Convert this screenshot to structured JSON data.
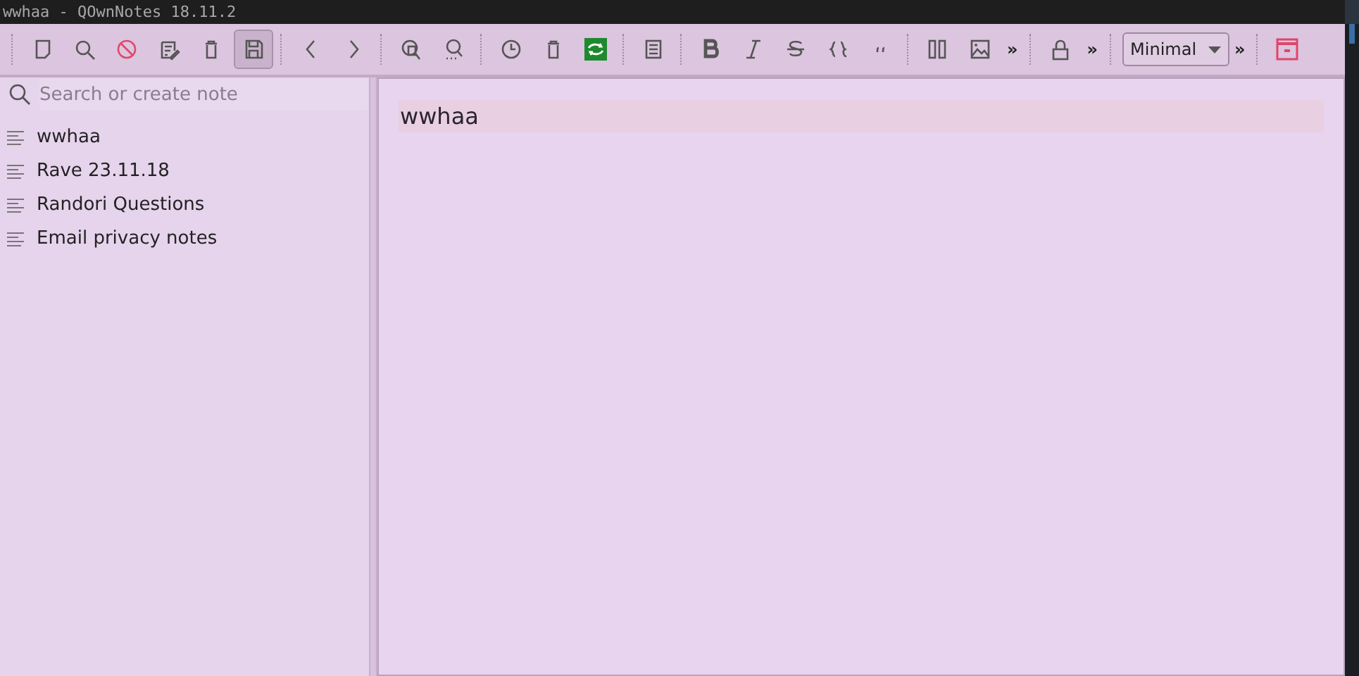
{
  "window": {
    "title": "wwhaa - QOwnNotes 18.11.2"
  },
  "toolbar": {
    "groups": [
      {
        "buttons": [
          {
            "pressed": false
          },
          {
            "pressed": false
          },
          {
            "pressed": false
          },
          {
            "pressed": false
          },
          {
            "pressed": false
          },
          {
            "pressed": true
          }
        ]
      },
      {
        "buttons": [
          {
            "pressed": false
          },
          {
            "pressed": false
          }
        ]
      },
      {
        "buttons": [
          {
            "pressed": false
          },
          {
            "pressed": false
          }
        ]
      },
      {
        "buttons": [
          {
            "pressed": false
          },
          {
            "pressed": false
          },
          {
            "pressed": false
          }
        ]
      },
      {
        "buttons": [
          {
            "pressed": false
          }
        ]
      },
      {
        "buttons": [
          {
            "pressed": false
          },
          {
            "pressed": false
          },
          {
            "pressed": false
          },
          {
            "pressed": false
          },
          {
            "pressed": false
          }
        ]
      },
      {
        "buttons": [
          {
            "pressed": false
          },
          {
            "pressed": false
          }
        ],
        "overflow": "»"
      },
      {
        "buttons": [
          {
            "pressed": false
          }
        ],
        "overflow": "»"
      },
      {
        "workspace": "Minimal",
        "overflow": "»"
      },
      {
        "buttons": [
          {
            "pressed": false
          }
        ]
      }
    ]
  },
  "search": {
    "placeholder": "Search or create note"
  },
  "notes": [
    {
      "title": "wwhaa"
    },
    {
      "title": "Rave 23.11.18"
    },
    {
      "title": "Randori Questions"
    },
    {
      "title": "Email privacy notes"
    }
  ],
  "editor": {
    "heading": "wwhaa"
  }
}
